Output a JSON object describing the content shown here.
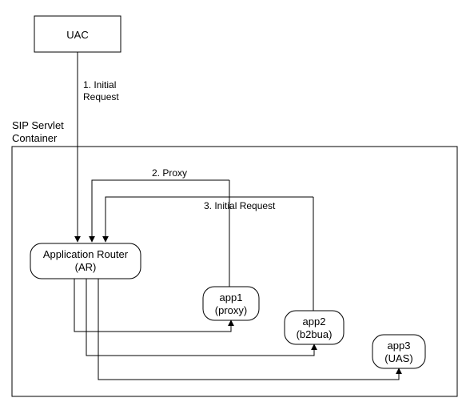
{
  "nodes": {
    "uac": {
      "label": "UAC"
    },
    "container": {
      "label_line1": "SIP Servlet",
      "label_line2": "Container"
    },
    "ar": {
      "line1": "Application Router",
      "line2": "(AR)"
    },
    "app1": {
      "line1": "app1",
      "line2": "(proxy)"
    },
    "app2": {
      "line1": "app2",
      "line2": "(b2bua)"
    },
    "app3": {
      "line1": "app3",
      "line2": "(UAS)"
    }
  },
  "edges": {
    "e1": {
      "line1": "1. Initial",
      "line2": "Request"
    },
    "e2": {
      "label": "2. Proxy"
    },
    "e3": {
      "label": "3. Initial Request"
    }
  }
}
